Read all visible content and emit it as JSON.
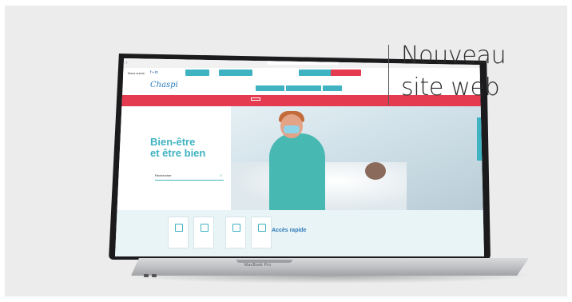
{
  "headline": {
    "line1": "Nouveau",
    "line2": "site web"
  },
  "laptop": {
    "model_label": "MacBook Pro"
  },
  "website": {
    "follow_text": "Nous suivre",
    "logo_text": "Chaspi",
    "hero_title_line1": "Bien-être",
    "hero_title_line2": "et être bien",
    "search_placeholder": "Rechercher",
    "quick_access_title": "Accès rapide",
    "accent_color": "#3fb3c1",
    "alert_color": "#e53b50"
  }
}
